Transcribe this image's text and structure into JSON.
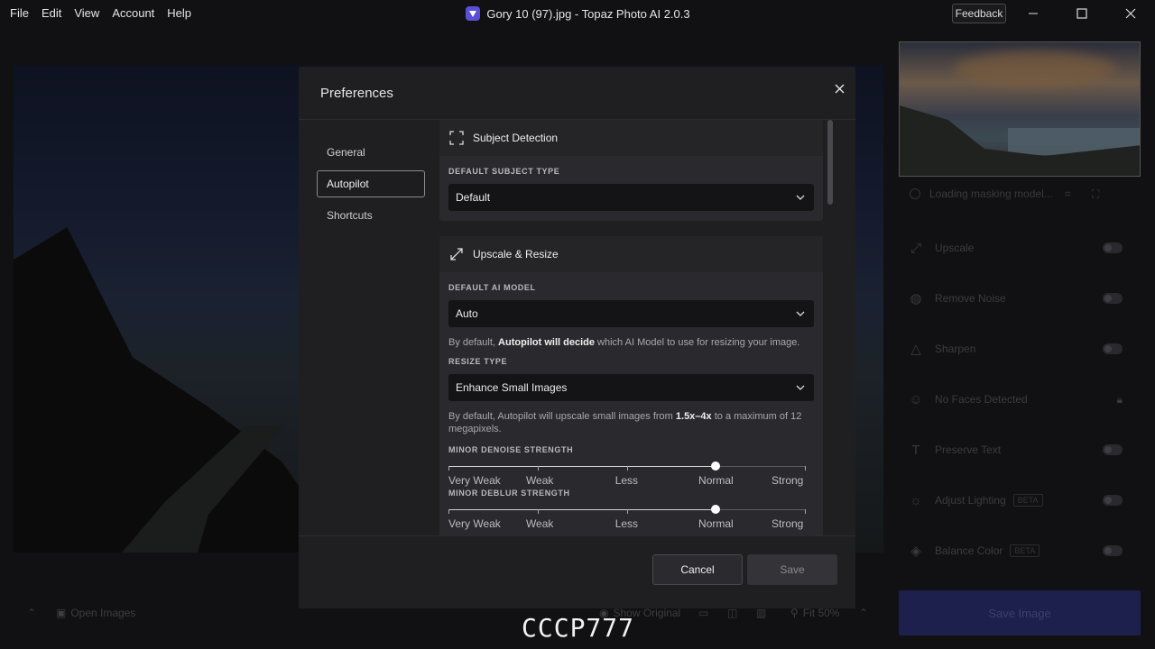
{
  "menu": [
    "File",
    "Edit",
    "View",
    "Account",
    "Help"
  ],
  "window": {
    "title": "Gory 10 (97).jpg - Topaz Photo AI 2.0.3",
    "feedback": "Feedback"
  },
  "right_panel": {
    "loading": "Loading masking model...",
    "items": [
      {
        "label": "Upscale",
        "icon": "upscale-icon"
      },
      {
        "label": "Remove Noise",
        "icon": "noise-icon"
      },
      {
        "label": "Sharpen",
        "icon": "sharpen-icon"
      },
      {
        "label": "No Faces Detected",
        "icon": "face-icon"
      },
      {
        "label": "Preserve Text",
        "icon": "text-icon"
      },
      {
        "label": "Adjust Lighting",
        "icon": "lighting-icon",
        "badge": "BETA"
      },
      {
        "label": "Balance Color",
        "icon": "color-icon",
        "badge": "BETA"
      }
    ],
    "save_image": "Save Image"
  },
  "bottom": {
    "open_images": "Open Images",
    "show_original": "Show Original",
    "zoom": "Fit 50%"
  },
  "watermark": "CCCP777",
  "prefs": {
    "title": "Preferences",
    "nav": [
      "General",
      "Autopilot",
      "Shortcuts"
    ],
    "active_nav": "Autopilot",
    "subject": {
      "heading": "Subject Detection",
      "label": "DEFAULT SUBJECT TYPE",
      "value": "Default"
    },
    "upscale": {
      "heading": "Upscale & Resize",
      "model_label": "DEFAULT AI MODEL",
      "model_value": "Auto",
      "model_desc_pre": "By default, ",
      "model_desc_bold": "Autopilot will decide",
      "model_desc_post": " which AI Model to use for resizing your image.",
      "resize_label": "RESIZE TYPE",
      "resize_value": "Enhance Small Images",
      "resize_desc_pre": "By default, Autopilot will upscale small images from ",
      "resize_desc_bold": "1.5x–4x",
      "resize_desc_post": " to a maximum of 12 megapixels.",
      "denoise_label": "MINOR DENOISE STRENGTH",
      "deblur_label": "MINOR DEBLUR STRENGTH",
      "slider_stops": [
        "Very Weak",
        "Weak",
        "Less",
        "Normal",
        "Strong"
      ],
      "denoise_level": 0.75,
      "deblur_level": 0.75
    },
    "cancel": "Cancel",
    "save": "Save"
  },
  "colors": {
    "modal_bg": "#1f1f22",
    "save_image_bg": "#1d1f4d"
  }
}
